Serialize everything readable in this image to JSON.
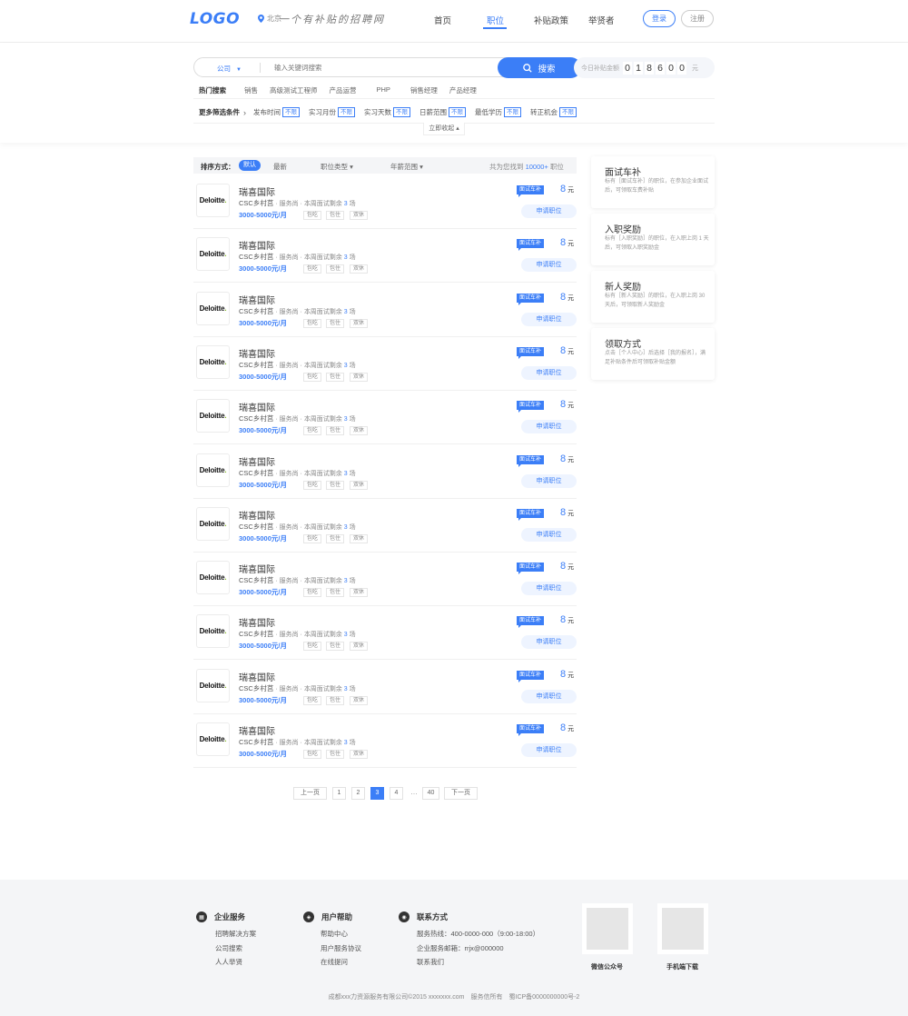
{
  "header": {
    "logo": "LOGO",
    "city": "北京",
    "slogan": "一个有补贴的招聘网",
    "nav": [
      "首页",
      "职位",
      "补贴政策",
      "举贤者"
    ],
    "login": "登录",
    "register": "注册",
    "accent": "#3b7ef7"
  },
  "search": {
    "type": "公司",
    "placeholder": "输入关键词搜索",
    "button": "搜索",
    "counter_label": "今日补贴金额",
    "counter_digits": [
      "0",
      "1",
      "8",
      "6",
      "0",
      "0"
    ],
    "counter_unit": "元"
  },
  "hot": {
    "label": "热门搜索",
    "keywords": [
      "销售",
      "高级测试工程师",
      "产品运营",
      "PHP",
      "销售经理",
      "产品经理"
    ]
  },
  "filters": {
    "label": "更多筛选条件",
    "items": [
      {
        "name": "发布时间",
        "value": "不限"
      },
      {
        "name": "实习月份",
        "value": "不限"
      },
      {
        "name": "实习天数",
        "value": "不限"
      },
      {
        "name": "日薪范围",
        "value": "不限"
      },
      {
        "name": "最低学历",
        "value": "不限"
      },
      {
        "name": "转正机会",
        "value": "不限"
      }
    ],
    "collapse": "立即收起 ▴"
  },
  "sort": {
    "label": "排序方式：",
    "default": "默认",
    "latest": "最新",
    "job_type": "职位类型 ▾",
    "salary": "年薪范围 ▾",
    "total_prefix": "共为您找到",
    "total_count": "10000+",
    "total_suffix": "职位"
  },
  "jobs": [
    {
      "company": "瑞喜国际",
      "logo": "Deloitte",
      "position": "CSC乡村莒",
      "category": "服务尚",
      "interviews_label": "本周面试剩余",
      "interviews": "3",
      "interviews_unit": "场",
      "salary": "3000-5000元/月",
      "perks": [
        "包吃",
        "包住",
        "双休"
      ],
      "badge": "面试车补",
      "amount": "8",
      "unit": "元",
      "apply": "申请职位"
    },
    {
      "company": "瑞喜国际",
      "logo": "Deloitte",
      "position": "CSC乡村莒",
      "category": "服务尚",
      "interviews_label": "本周面试剩余",
      "interviews": "3",
      "interviews_unit": "场",
      "salary": "3000-5000元/月",
      "perks": [
        "包吃",
        "包住",
        "双休"
      ],
      "badge": "面试车补",
      "amount": "8",
      "unit": "元",
      "apply": "申请职位"
    },
    {
      "company": "瑞喜国际",
      "logo": "Deloitte",
      "position": "CSC乡村莒",
      "category": "服务尚",
      "interviews_label": "本周面试剩余",
      "interviews": "3",
      "interviews_unit": "场",
      "salary": "3000-5000元/月",
      "perks": [
        "包吃",
        "包住",
        "双休"
      ],
      "badge": "面试车补",
      "amount": "8",
      "unit": "元",
      "apply": "申请职位"
    },
    {
      "company": "瑞喜国际",
      "logo": "Deloitte",
      "position": "CSC乡村莒",
      "category": "服务尚",
      "interviews_label": "本周面试剩余",
      "interviews": "3",
      "interviews_unit": "场",
      "salary": "3000-5000元/月",
      "perks": [
        "包吃",
        "包住",
        "双休"
      ],
      "badge": "面试车补",
      "amount": "8",
      "unit": "元",
      "apply": "申请职位"
    },
    {
      "company": "瑞喜国际",
      "logo": "Deloitte",
      "position": "CSC乡村莒",
      "category": "服务尚",
      "interviews_label": "本周面试剩余",
      "interviews": "3",
      "interviews_unit": "场",
      "salary": "3000-5000元/月",
      "perks": [
        "包吃",
        "包住",
        "双休"
      ],
      "badge": "面试车补",
      "amount": "8",
      "unit": "元",
      "apply": "申请职位"
    },
    {
      "company": "瑞喜国际",
      "logo": "Deloitte",
      "position": "CSC乡村莒",
      "category": "服务尚",
      "interviews_label": "本周面试剩余",
      "interviews": "3",
      "interviews_unit": "场",
      "salary": "3000-5000元/月",
      "perks": [
        "包吃",
        "包住",
        "双休"
      ],
      "badge": "面试车补",
      "amount": "8",
      "unit": "元",
      "apply": "申请职位"
    },
    {
      "company": "瑞喜国际",
      "logo": "Deloitte",
      "position": "CSC乡村莒",
      "category": "服务尚",
      "interviews_label": "本周面试剩余",
      "interviews": "3",
      "interviews_unit": "场",
      "salary": "3000-5000元/月",
      "perks": [
        "包吃",
        "包住",
        "双休"
      ],
      "badge": "面试车补",
      "amount": "8",
      "unit": "元",
      "apply": "申请职位"
    },
    {
      "company": "瑞喜国际",
      "logo": "Deloitte",
      "position": "CSC乡村莒",
      "category": "服务尚",
      "interviews_label": "本周面试剩余",
      "interviews": "3",
      "interviews_unit": "场",
      "salary": "3000-5000元/月",
      "perks": [
        "包吃",
        "包住",
        "双休"
      ],
      "badge": "面试车补",
      "amount": "8",
      "unit": "元",
      "apply": "申请职位"
    },
    {
      "company": "瑞喜国际",
      "logo": "Deloitte",
      "position": "CSC乡村莒",
      "category": "服务尚",
      "interviews_label": "本周面试剩余",
      "interviews": "3",
      "interviews_unit": "场",
      "salary": "3000-5000元/月",
      "perks": [
        "包吃",
        "包住",
        "双休"
      ],
      "badge": "面试车补",
      "amount": "8",
      "unit": "元",
      "apply": "申请职位"
    },
    {
      "company": "瑞喜国际",
      "logo": "Deloitte",
      "position": "CSC乡村莒",
      "category": "服务尚",
      "interviews_label": "本周面试剩余",
      "interviews": "3",
      "interviews_unit": "场",
      "salary": "3000-5000元/月",
      "perks": [
        "包吃",
        "包住",
        "双休"
      ],
      "badge": "面试车补",
      "amount": "8",
      "unit": "元",
      "apply": "申请职位"
    },
    {
      "company": "瑞喜国际",
      "logo": "Deloitte",
      "position": "CSC乡村莒",
      "category": "服务尚",
      "interviews_label": "本周面试剩余",
      "interviews": "3",
      "interviews_unit": "场",
      "salary": "3000-5000元/月",
      "perks": [
        "包吃",
        "包住",
        "双休"
      ],
      "badge": "面试车补",
      "amount": "8",
      "unit": "元",
      "apply": "申请职位"
    }
  ],
  "sidebar": [
    {
      "title": "面试车补",
      "desc": "标有［面试车补］的职位，在参加企业面试后，可领取车费补贴"
    },
    {
      "title": "入职奖励",
      "desc": "标有［入职奖励］的职位，在入职上岗 1 天后，可领取入职奖励金"
    },
    {
      "title": "新人奖励",
      "desc": "标有［新人奖励］的职位，在入职上岗 30 天后，可领取新人奖励金"
    },
    {
      "title": "领取方式",
      "desc": "点击［个人中心］后选择［我的报名］，满足补贴条件后可领取补贴金额"
    }
  ],
  "pagination": {
    "prev": "上一页",
    "pages": [
      "1",
      "2",
      "3",
      "4"
    ],
    "current": "3",
    "ellipsis": "…",
    "last": "40",
    "next": "下一页"
  },
  "footer": {
    "columns": [
      {
        "title": "企业服务",
        "icon": "grid-icon",
        "links": [
          "招聘解决方案",
          "公司搜索",
          "人人举贤"
        ]
      },
      {
        "title": "用户帮助",
        "icon": "shield-icon",
        "links": [
          "帮助中心",
          "用户服务协议",
          "在线提问"
        ]
      },
      {
        "title": "联系方式",
        "icon": "eye-icon",
        "links": [
          "服务热线：400-0000-000（9:00-18:00）",
          "企业服务邮箱：rrjx@000000",
          "联系我们"
        ]
      }
    ],
    "qr": [
      "微信公众号",
      "手机端下载"
    ],
    "copyright": "成都xxx力资源服务有限公司©2015 xxxxxxx.com　服务信所有　蜀ICP备0000000000号-2"
  }
}
